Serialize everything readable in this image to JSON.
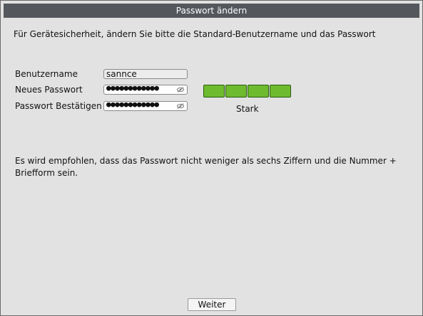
{
  "window": {
    "title": "Passwort ändern"
  },
  "intro_text": "Für Gerätesicherheit, ändern Sie bitte die Standard-Benutzername und das Passwort",
  "form": {
    "username_label": "Benutzername",
    "username_value": "sannce",
    "new_password_label": "Neues Passwort",
    "new_password_masked": "●●●●●●●●●●●●",
    "confirm_password_label": "Passwort Bestätigen",
    "confirm_password_masked": "●●●●●●●●●●●●"
  },
  "strength": {
    "segments_filled": 4,
    "segments_total": 4,
    "label": "Stark",
    "color": "#6fbb2f"
  },
  "note_text": "Es wird empfohlen, dass das Passwort nicht weniger als sechs Ziffern und die Nummer + Briefform sein.",
  "buttons": {
    "next_label": "Weiter"
  },
  "icons": {
    "password_visibility": "eye-hidden-icon"
  }
}
